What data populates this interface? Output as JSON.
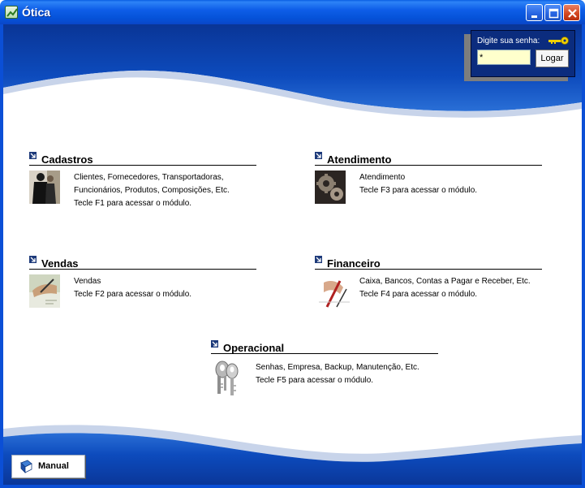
{
  "window": {
    "title": "Ótica",
    "controls": {
      "minimize": "minimize-icon",
      "maximize": "maximize-icon",
      "close": "close-icon"
    }
  },
  "login": {
    "label": "Digite sua senha:",
    "password_value": "*",
    "button_label": "Logar",
    "icon": "key-icon"
  },
  "modules": {
    "cadastros": {
      "title": "Cadastros",
      "line1": "Clientes,  Fornecedores,  Transportadoras,",
      "line2": "Funcionários, Produtos, Composições, Etc.",
      "line3": "Tecle F1 para acessar o módulo.",
      "icon": "people-icon"
    },
    "atendimento": {
      "title": "Atendimento",
      "line1": "Atendimento",
      "line2": "Tecle F3 para acessar o módulo.",
      "icon": "gears-icon"
    },
    "vendas": {
      "title": "Vendas",
      "line1": "Vendas",
      "line2": "Tecle F2 para acessar o módulo.",
      "icon": "signing-hand-icon"
    },
    "financeiro": {
      "title": "Financeiro",
      "line1": "Caixa, Bancos, Contas a Pagar e Receber, Etc.",
      "line2": "Tecle F4 para acessar o módulo.",
      "icon": "pen-hand-icon"
    },
    "operacional": {
      "title": "Operacional",
      "line1": "Senhas, Empresa, Backup, Manutenção, Etc.",
      "line2": "Tecle F5 para acessar o módulo.",
      "icon": "keys-icon"
    }
  },
  "manual_button": {
    "label": "Manual",
    "icon": "book-icon"
  },
  "colors": {
    "titlebar": "#0a5fe3",
    "wave_blue": "#0b3fa8",
    "login_panel": "#0b2c7e",
    "password_bg": "#ffffcc"
  }
}
